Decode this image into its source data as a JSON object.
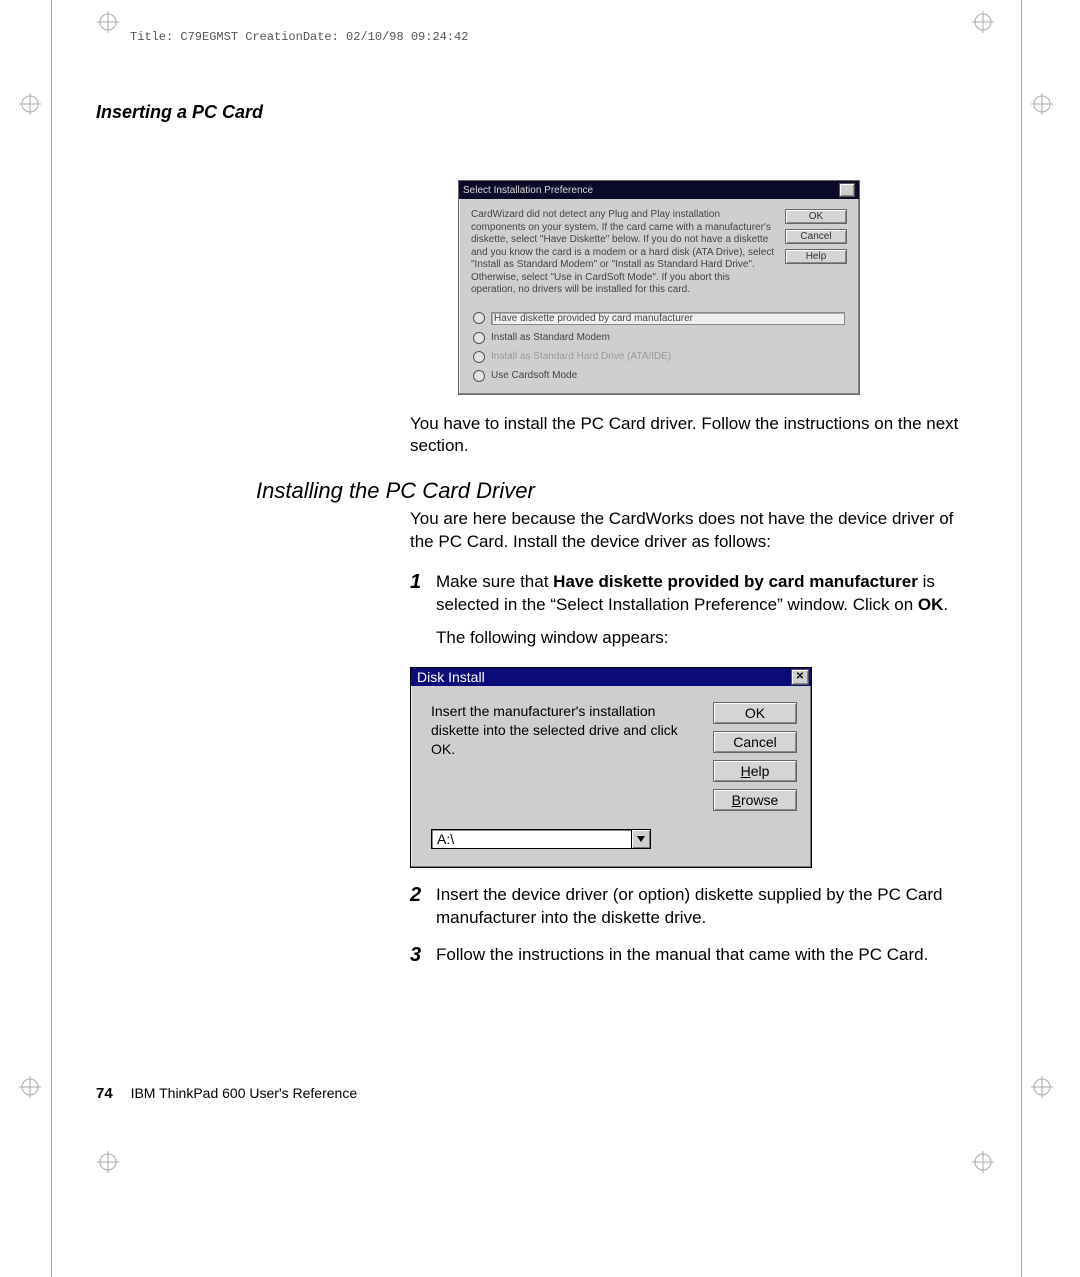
{
  "meta_header": "Title: C79EGMST CreationDate: 02/10/98 09:24:42",
  "running_head": "Inserting a PC Card",
  "dialog1": {
    "title": "Select Installation Preference",
    "instructions": "CardWizard did not detect any Plug and Play installation components on your system. If the card came with a manufacturer's diskette, select \"Have Diskette\" below. If you do not have a diskette and you know the card is a modem or a hard disk (ATA Drive), select \"Install as Standard Modem\" or \"Install as Standard Hard Drive\". Otherwise, select \"Use in CardSoft Mode\". If you abort this operation, no drivers will be installed for this card.",
    "options": {
      "have_diskette": "Have diskette provided by card manufacturer",
      "std_modem": "Install as Standard Modem",
      "std_hd": "Install as Standard Hard Drive (ATA/IDE)",
      "cardsoft": "Use Cardsoft Mode"
    },
    "buttons": {
      "ok": "OK",
      "cancel": "Cancel",
      "help": "Help"
    }
  },
  "after_dlg1": "You have to install the PC Card driver.  Follow the instructions on the next section.",
  "subhead": "Installing the PC Card Driver",
  "intro": "You are here because the CardWorks does not have the device driver of the PC Card.  Install the device driver as follows:",
  "step1_a": "Make sure that ",
  "step1_bold": "Have diskette provided by card manufacturer",
  "step1_b": " is selected in the “Select Installation Preference” window.  Click on ",
  "step1_ok": "OK",
  "step1_c": ".",
  "after_step1": "The following window appears:",
  "dialog2": {
    "title": "Disk Install",
    "msg": "Insert the manufacturer's installation diskette into the selected drive and click OK.",
    "ok": "OK",
    "cancel": "Cancel",
    "help_u": "H",
    "help_rest": "elp",
    "browse_u": "B",
    "browse_rest": "rowse",
    "drive": "A:\\"
  },
  "step2": "Insert the device driver (or option) diskette supplied by the PC Card manufacturer into the diskette drive.",
  "step3": "Follow the instructions in the manual that came with the PC Card.",
  "footer_page": "74",
  "footer_book": "IBM ThinkPad 600 User's Reference"
}
